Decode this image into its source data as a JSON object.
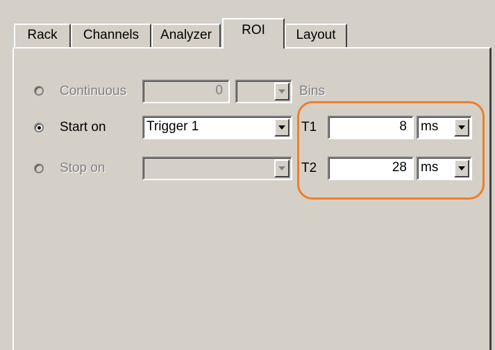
{
  "tabs": [
    {
      "label": "Rack"
    },
    {
      "label": "Channels"
    },
    {
      "label": "Analyzer"
    },
    {
      "label": "ROI"
    },
    {
      "label": "Layout"
    }
  ],
  "active_tab": "ROI",
  "roi": {
    "continuous": {
      "label": "Continuous",
      "value": "0",
      "bins_label": "Bins",
      "enabled": false,
      "selected": false
    },
    "start_on": {
      "label": "Start on",
      "value": "Trigger 1",
      "enabled": true,
      "selected": true
    },
    "stop_on": {
      "label": "Stop on",
      "value": "",
      "enabled": false,
      "selected": false
    }
  },
  "timing": {
    "t1": {
      "label": "T1",
      "value": "8",
      "unit": "ms"
    },
    "t2": {
      "label": "T2",
      "value": "28",
      "unit": "ms"
    }
  },
  "colors": {
    "highlight": "#f07e26",
    "window_bg": "#d4d0c8"
  }
}
